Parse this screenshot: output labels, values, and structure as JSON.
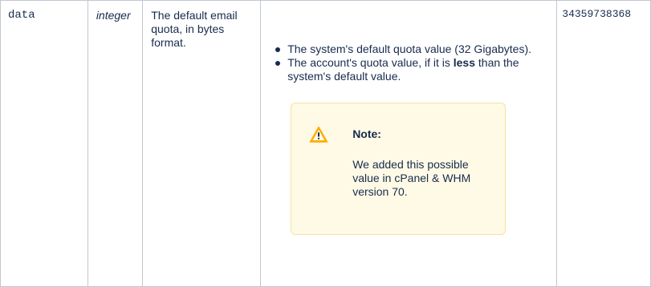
{
  "row": {
    "parameter": "data",
    "type": "integer",
    "description": "The default email quota, in bytes format.",
    "values": {
      "item1": "The system's default quota value (32 Gigabytes).",
      "item2_prefix": "The account's quota value, if it is ",
      "item2_bold": "less",
      "item2_suffix": " than the system's default value."
    },
    "note": {
      "icon": "warning-icon",
      "title": "Note:",
      "body": "We added this possible value in cPanel & WHM version 70."
    },
    "example": "34359738368"
  },
  "colors": {
    "border": "#c1c7d0",
    "text": "#172b4d",
    "note_background": "#fffae6",
    "note_border": "#f5e29f",
    "warning": "#ffab00"
  }
}
